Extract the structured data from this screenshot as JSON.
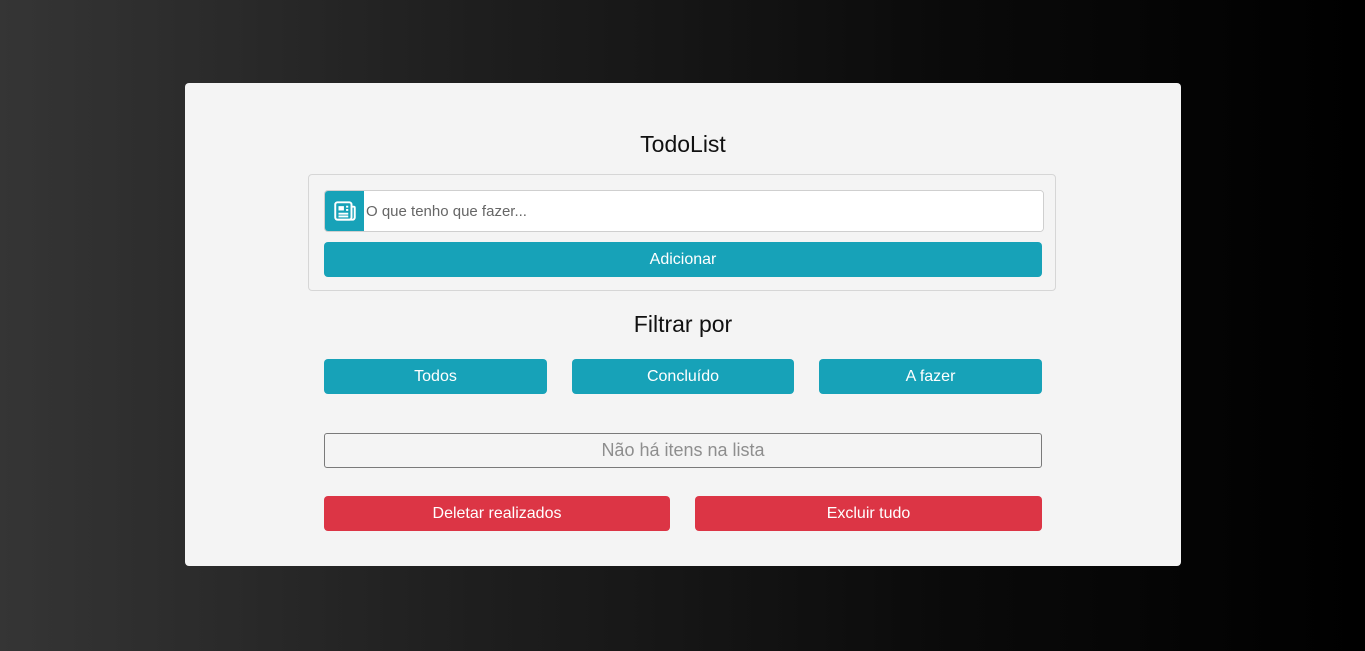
{
  "app": {
    "title": "TodoList"
  },
  "form": {
    "input_placeholder": "O que tenho que fazer...",
    "input_value": "",
    "input_icon": "newspaper-icon",
    "add_label": "Adicionar"
  },
  "filter": {
    "title": "Filtrar por",
    "options": [
      {
        "label": "Todos"
      },
      {
        "label": "Concluído"
      },
      {
        "label": "A fazer"
      }
    ]
  },
  "list": {
    "empty_message": "Não há itens na lista"
  },
  "actions": {
    "delete_done_label": "Deletar realizados",
    "delete_all_label": "Excluir tudo"
  },
  "colors": {
    "info": "#17a2b8",
    "danger": "#dc3545",
    "card_bg": "#f4f4f4"
  }
}
